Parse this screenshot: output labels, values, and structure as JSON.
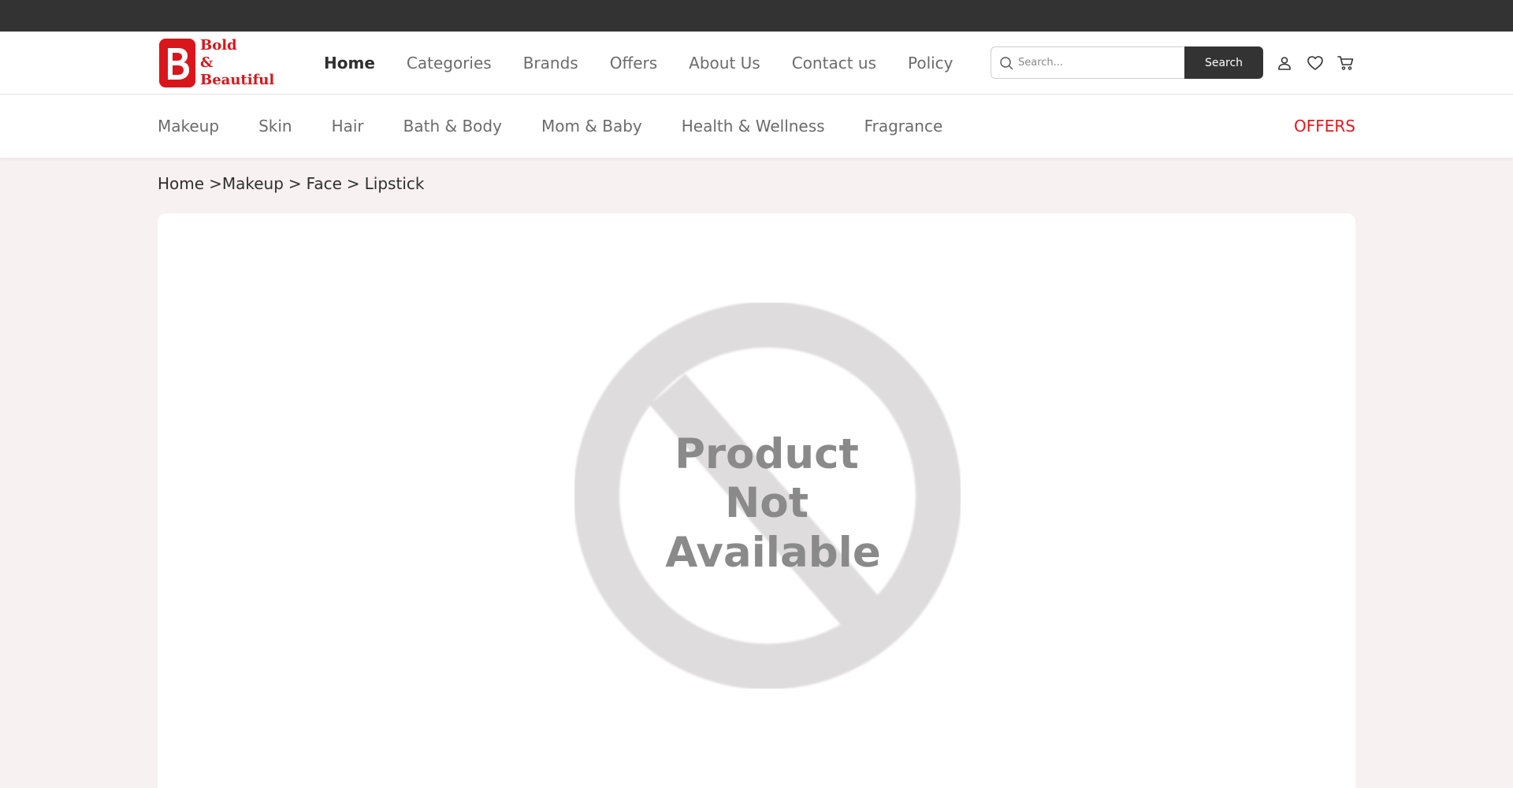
{
  "brand": {
    "line1": "Bold",
    "line2": "&",
    "line3": "Beautiful",
    "color": "#d9161c"
  },
  "main_nav": [
    {
      "label": "Home",
      "active": true
    },
    {
      "label": "Categories"
    },
    {
      "label": "Brands"
    },
    {
      "label": "Offers"
    },
    {
      "label": "About Us"
    },
    {
      "label": "Contact us"
    },
    {
      "label": "Policy"
    }
  ],
  "search": {
    "placeholder": "Search...",
    "button_label": "Search"
  },
  "header_icons": [
    "user-icon",
    "heart-icon",
    "cart-icon"
  ],
  "category_nav": [
    {
      "label": "Makeup"
    },
    {
      "label": "Skin"
    },
    {
      "label": "Hair"
    },
    {
      "label": "Bath & Body"
    },
    {
      "label": "Mom & Baby"
    },
    {
      "label": "Health & Wellness"
    },
    {
      "label": "Fragrance"
    }
  ],
  "offers_link": {
    "label": "OFFERS",
    "color": "#e4171e"
  },
  "breadcrumb": {
    "items": [
      "Home",
      "Makeup",
      "Face",
      "Lipstick"
    ],
    "separator": ">"
  },
  "product_image": {
    "line1": "Product",
    "line2": "Not",
    "line3": "Available"
  }
}
